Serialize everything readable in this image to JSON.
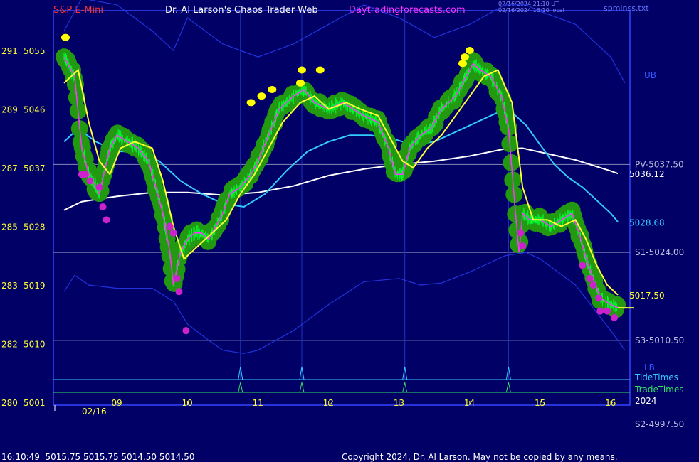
{
  "header": {
    "symbol": "S&P E-Mini",
    "site_title": "Dr. Al Larson's Chaos Trader Web",
    "link": "Daytradingforecasts.com",
    "timestamp_ut": "02/16/2024 21:10 UT",
    "timestamp_local": "02/16/2024 16:10 local",
    "file_label": "spminss.txt"
  },
  "footer": {
    "quote": "16:10:49  5015.75 5015.75 5014.50 5014.50",
    "copyright": "Copyright 2024, Dr. Al Larson. May not be copied by any means."
  },
  "colors": {
    "background": "#000066",
    "border": "#3344ff",
    "price_bars": "#00ff33",
    "price_halo": "#229911",
    "magenta_line": "#ff33ff",
    "yellow_line": "#ffff33",
    "cyan_ma": "#33ccff",
    "white_ma": "#ffffff",
    "bands": "#2233dd",
    "levels": "#8888bb",
    "tide_times": "#33ccff",
    "trade_times": "#33dd66"
  },
  "chart_data": {
    "type": "line",
    "x_axis": {
      "hour_labels": [
        "09",
        "10",
        "11",
        "12",
        "13",
        "14",
        "15",
        "16"
      ],
      "date_label": "02/16",
      "year_label": "2024",
      "x_range_hours": [
        8.25,
        16.25
      ]
    },
    "y_axis": {
      "price_range": [
        5001,
        5060
      ],
      "ticks": [
        {
          "left": "291",
          "price": "5055",
          "value": 5055
        },
        {
          "left": "289",
          "price": "5046",
          "value": 5046
        },
        {
          "left": "287",
          "price": "5037",
          "value": 5037
        },
        {
          "left": "285",
          "price": "5028",
          "value": 5028
        },
        {
          "left": "283",
          "price": "5019",
          "value": 5019
        },
        {
          "left": "282",
          "price": "5010",
          "value": 5010
        },
        {
          "left": "280",
          "price": "5001",
          "value": 5001
        }
      ]
    },
    "levels": [
      {
        "label": "PV-5037.50",
        "value": 5037.5
      },
      {
        "label": "S1-5024.00",
        "value": 5024.0
      },
      {
        "label": "S3-5010.50",
        "value": 5010.5
      },
      {
        "label": "S2-4997.50",
        "value": 4997.5
      }
    ],
    "band_labels": {
      "upper": "UB",
      "lower": "LB"
    },
    "value_labels": [
      {
        "label": "5036.12",
        "value": 5036.12,
        "color": "#ffffff"
      },
      {
        "label": "5028.68",
        "value": 5028.68,
        "color": "#33ccff"
      },
      {
        "label": "5017.50",
        "value": 5017.5,
        "color": "#ffff33"
      }
    ],
    "timing_lines": {
      "tide_label": "TideTimes",
      "trade_label": "TradeTimes",
      "times": [
        10.75,
        11.62,
        13.08,
        14.55
      ]
    },
    "series": [
      {
        "key": "price",
        "x": [
          8.25,
          8.4,
          8.5,
          8.6,
          8.75,
          8.9,
          9.0,
          9.15,
          9.3,
          9.45,
          9.55,
          9.65,
          9.75,
          9.8,
          9.9,
          10.0,
          10.1,
          10.2,
          10.3,
          10.4,
          10.5,
          10.6,
          10.75,
          10.9,
          11.0,
          11.15,
          11.3,
          11.5,
          11.65,
          11.8,
          12.0,
          12.2,
          12.35,
          12.5,
          12.7,
          12.85,
          12.95,
          13.05,
          13.15,
          13.3,
          13.45,
          13.6,
          13.8,
          13.95,
          14.05,
          14.15,
          14.3,
          14.45,
          14.55,
          14.65,
          14.7,
          14.75,
          14.85,
          15.0,
          15.15,
          15.3,
          15.45,
          15.55,
          15.65,
          15.75,
          15.85,
          16.0,
          16.1
        ],
        "values": [
          5054,
          5051,
          5040,
          5036,
          5033,
          5040,
          5042,
          5041,
          5040,
          5038,
          5034,
          5030,
          5024,
          5019,
          5024,
          5026,
          5027,
          5027,
          5026,
          5028,
          5030,
          5033,
          5034,
          5036,
          5038,
          5042,
          5046,
          5048,
          5049,
          5047,
          5046,
          5047,
          5046,
          5045,
          5044,
          5040,
          5036,
          5036,
          5040,
          5042,
          5043,
          5046,
          5048,
          5051,
          5053,
          5052,
          5051,
          5048,
          5043,
          5030,
          5024,
          5030,
          5029,
          5029,
          5028,
          5029,
          5030,
          5027,
          5023,
          5020,
          5017,
          5016,
          5015.5
        ]
      },
      {
        "key": "yellow",
        "x": [
          8.25,
          8.45,
          8.6,
          8.75,
          8.9,
          9.05,
          9.25,
          9.5,
          9.65,
          9.8,
          9.95,
          10.15,
          10.35,
          10.55,
          10.75,
          10.95,
          11.15,
          11.35,
          11.6,
          11.8,
          12.0,
          12.25,
          12.45,
          12.7,
          12.9,
          13.05,
          13.2,
          13.4,
          13.6,
          13.8,
          14.0,
          14.2,
          14.4,
          14.6,
          14.75,
          14.9,
          15.1,
          15.3,
          15.5,
          15.65,
          15.8,
          15.95,
          16.1
        ],
        "values": [
          5050,
          5052,
          5044,
          5038,
          5036,
          5040,
          5041,
          5040,
          5035,
          5028,
          5023,
          5025,
          5027,
          5029,
          5033,
          5036,
          5040,
          5044,
          5047,
          5048,
          5046,
          5047,
          5046,
          5045,
          5041,
          5038,
          5037,
          5040,
          5042,
          5045,
          5048,
          5051,
          5052,
          5047,
          5034,
          5029,
          5029,
          5028,
          5029,
          5026,
          5022,
          5019,
          5017.5
        ]
      },
      {
        "key": "cyan_ma",
        "x": [
          8.25,
          8.45,
          8.7,
          9.0,
          9.3,
          9.6,
          9.9,
          10.2,
          10.5,
          10.8,
          11.1,
          11.4,
          11.7,
          12.0,
          12.3,
          12.6,
          12.9,
          13.2,
          13.5,
          13.8,
          14.1,
          14.4,
          14.6,
          14.8,
          15.0,
          15.2,
          15.4,
          15.6,
          15.8,
          16.0,
          16.1
        ],
        "values": [
          5041,
          5043,
          5041,
          5039.5,
          5039.5,
          5038,
          5035,
          5033,
          5031.5,
          5031,
          5033,
          5036.5,
          5039.5,
          5041,
          5042,
          5042,
          5041.5,
          5040.5,
          5041,
          5042.5,
          5044,
          5045.5,
          5045.5,
          5043.5,
          5040.5,
          5037.5,
          5035.5,
          5034,
          5032,
          5030,
          5028.7
        ]
      },
      {
        "key": "white_ma",
        "x": [
          8.25,
          8.5,
          9.0,
          9.5,
          10.0,
          10.5,
          11.0,
          11.5,
          12.0,
          12.5,
          13.0,
          13.5,
          14.0,
          14.5,
          14.75,
          15.0,
          15.5,
          16.0,
          16.1
        ],
        "values": [
          5030.5,
          5031.8,
          5032.6,
          5033.2,
          5033.2,
          5032.8,
          5033.2,
          5034.2,
          5035.8,
          5036.8,
          5037.5,
          5038,
          5038.8,
          5039.9,
          5040,
          5039.4,
          5038.2,
          5036.5,
          5036.1
        ]
      },
      {
        "key": "upper_band",
        "x": [
          8.25,
          8.5,
          9.0,
          9.5,
          9.8,
          10.0,
          10.5,
          11.0,
          11.5,
          12.0,
          12.5,
          13.0,
          13.5,
          14.0,
          14.5,
          14.8,
          15.0,
          15.5,
          16.0,
          16.2
        ],
        "values": [
          5058,
          5063,
          5062,
          5058,
          5055,
          5060,
          5056,
          5054,
          5056,
          5059,
          5062,
          5060,
          5057,
          5059,
          5062,
          5062,
          5061,
          5059,
          5054,
          5050
        ]
      },
      {
        "key": "lower_band",
        "x": [
          8.25,
          8.4,
          8.6,
          9.0,
          9.5,
          9.8,
          10.0,
          10.3,
          10.5,
          10.8,
          11.0,
          11.5,
          12.0,
          12.5,
          13.0,
          13.3,
          13.6,
          14.0,
          14.5,
          14.8,
          15.0,
          15.5,
          16.0,
          16.2
        ],
        "values": [
          5018,
          5020.5,
          5019,
          5018.5,
          5018.5,
          5016.5,
          5013,
          5010.5,
          5009,
          5008.5,
          5009,
          5012,
          5016,
          5019.5,
          5020,
          5019,
          5019.3,
          5021,
          5023.5,
          5024,
          5023,
          5019,
          5012,
          5009
        ]
      }
    ],
    "yellow_markers": [
      [
        8.27,
        5057
      ],
      [
        10.9,
        5047
      ],
      [
        11.05,
        5048
      ],
      [
        11.2,
        5049
      ],
      [
        11.6,
        5050
      ],
      [
        11.62,
        5052
      ],
      [
        11.88,
        5052
      ],
      [
        13.9,
        5053
      ],
      [
        13.93,
        5054
      ],
      [
        14.0,
        5055
      ]
    ],
    "magenta_markers": [
      [
        8.5,
        5036
      ],
      [
        8.55,
        5036
      ],
      [
        8.62,
        5035
      ],
      [
        8.75,
        5034
      ],
      [
        8.8,
        5031
      ],
      [
        8.85,
        5029
      ],
      [
        9.75,
        5028
      ],
      [
        9.8,
        5027
      ],
      [
        9.85,
        5020
      ],
      [
        9.88,
        5018
      ],
      [
        9.98,
        5012
      ],
      [
        14.72,
        5027
      ],
      [
        14.75,
        5025
      ],
      [
        15.6,
        5022
      ],
      [
        15.7,
        5020
      ],
      [
        15.75,
        5019
      ],
      [
        15.83,
        5017
      ],
      [
        15.85,
        5015
      ],
      [
        15.95,
        5015
      ],
      [
        16.05,
        5014
      ]
    ]
  }
}
